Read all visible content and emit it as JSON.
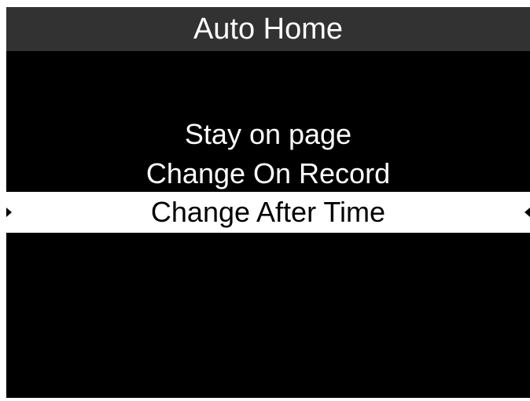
{
  "header": {
    "title": "Auto Home"
  },
  "menu": {
    "items": [
      {
        "label": "Stay on page"
      },
      {
        "label": "Change On Record"
      },
      {
        "label": "Change After Time"
      }
    ],
    "selected_index": 2
  },
  "colors": {
    "screen_background": "#000000",
    "title_bar_background": "#323232",
    "text": "#ffffff",
    "selection_background": "#ffffff",
    "selection_text": "#000000"
  },
  "icons": {
    "selection_left": "caret-right-icon",
    "selection_right": "caret-left-icon"
  }
}
